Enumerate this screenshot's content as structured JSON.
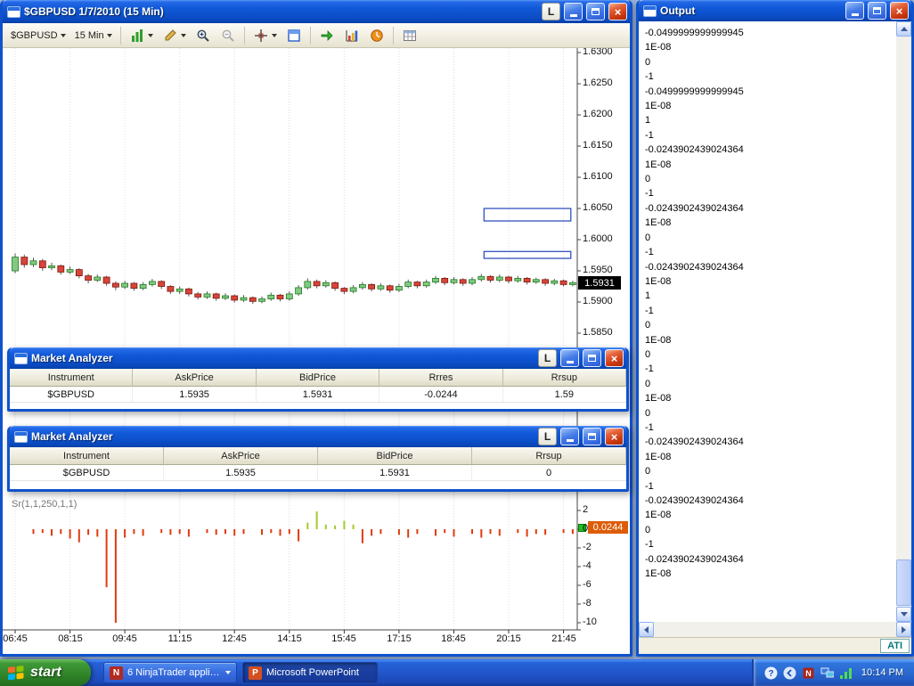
{
  "chart_window": {
    "title": "$GBPUSD  1/7/2010 (15 Min)",
    "link_label": "L",
    "toolbar": {
      "instrument": "$GBPUSD",
      "interval": "15 Min"
    },
    "price_axis_ticks": [
      "1.6300",
      "1.6250",
      "1.6200",
      "1.6150",
      "1.6100",
      "1.6050",
      "1.6000",
      "1.5950",
      "1.5900",
      "1.5850"
    ],
    "indicator_axis_ticks": [
      "2",
      "0",
      "-2",
      "-4",
      "-6",
      "-8",
      "-10"
    ],
    "time_axis_ticks": [
      "06:45",
      "08:15",
      "09:45",
      "11:15",
      "12:45",
      "14:15",
      "15:45",
      "17:15",
      "18:45",
      "20:15",
      "21:45"
    ],
    "price_marker": "1.5931",
    "indicator_label": "Sr(1,1,250,1,1)",
    "indicator_marker": "0.0244"
  },
  "chart_data": [
    {
      "type": "candlestick",
      "title": "$GBPUSD 1/7/2010 15 Min",
      "ylim": [
        1.585,
        1.63
      ],
      "y_ticks": [
        1.63,
        1.625,
        1.62,
        1.615,
        1.61,
        1.605,
        1.6,
        1.595,
        1.59,
        1.585
      ],
      "x_ticks": [
        "06:45",
        "08:15",
        "09:45",
        "11:15",
        "12:45",
        "14:15",
        "15:45",
        "17:15",
        "18:45",
        "20:15",
        "21:45"
      ],
      "last_price": 1.5931,
      "rectangles": [
        {
          "price_top": 1.605,
          "price_bottom": 1.603,
          "x1_bar": 51.3,
          "x2_bar": 60.8
        },
        {
          "price_top": 1.5981,
          "price_bottom": 1.597,
          "x1_bar": 51.3,
          "x2_bar": 60.8
        }
      ],
      "candles": [
        [
          1.595,
          1.5978,
          1.5946,
          1.5972
        ],
        [
          1.5972,
          1.5976,
          1.5955,
          1.596
        ],
        [
          1.596,
          1.5971,
          1.5956,
          1.5966
        ],
        [
          1.5966,
          1.5969,
          1.595,
          1.5955
        ],
        [
          1.5955,
          1.5963,
          1.5951,
          1.5958
        ],
        [
          1.5958,
          1.596,
          1.5944,
          1.5948
        ],
        [
          1.5948,
          1.5957,
          1.5945,
          1.5952
        ],
        [
          1.5952,
          1.5954,
          1.5938,
          1.5942
        ],
        [
          1.5942,
          1.5945,
          1.593,
          1.5935
        ],
        [
          1.5935,
          1.5944,
          1.5932,
          1.594
        ],
        [
          1.594,
          1.5942,
          1.5926,
          1.593
        ],
        [
          1.593,
          1.5933,
          1.5919,
          1.5924
        ],
        [
          1.5924,
          1.5934,
          1.5921,
          1.593
        ],
        [
          1.593,
          1.5932,
          1.5918,
          1.5922
        ],
        [
          1.5922,
          1.5932,
          1.5919,
          1.5928
        ],
        [
          1.5928,
          1.5937,
          1.5925,
          1.5933
        ],
        [
          1.5933,
          1.5935,
          1.5921,
          1.5925
        ],
        [
          1.5925,
          1.5927,
          1.5913,
          1.5917
        ],
        [
          1.5917,
          1.5925,
          1.5913,
          1.5921
        ],
        [
          1.5921,
          1.5923,
          1.5909,
          1.5913
        ],
        [
          1.5913,
          1.5916,
          1.5904,
          1.5908
        ],
        [
          1.5908,
          1.5917,
          1.5905,
          1.5913
        ],
        [
          1.5913,
          1.5915,
          1.5902,
          1.5906
        ],
        [
          1.5906,
          1.5914,
          1.5903,
          1.591
        ],
        [
          1.591,
          1.5912,
          1.5899,
          1.5903
        ],
        [
          1.5903,
          1.5911,
          1.59,
          1.5907
        ],
        [
          1.5907,
          1.5909,
          1.5897,
          1.5901
        ],
        [
          1.5901,
          1.5909,
          1.5898,
          1.5905
        ],
        [
          1.5905,
          1.5915,
          1.5902,
          1.5911
        ],
        [
          1.5911,
          1.5913,
          1.5901,
          1.5905
        ],
        [
          1.5905,
          1.5917,
          1.5902,
          1.5913
        ],
        [
          1.5913,
          1.5927,
          1.591,
          1.5923
        ],
        [
          1.5923,
          1.5938,
          1.592,
          1.5933
        ],
        [
          1.5933,
          1.5936,
          1.5922,
          1.5926
        ],
        [
          1.5926,
          1.5935,
          1.5923,
          1.5931
        ],
        [
          1.5931,
          1.5933,
          1.5918,
          1.5922
        ],
        [
          1.5922,
          1.5924,
          1.5913,
          1.5917
        ],
        [
          1.5917,
          1.5927,
          1.5914,
          1.5923
        ],
        [
          1.5923,
          1.5932,
          1.592,
          1.5928
        ],
        [
          1.5928,
          1.593,
          1.5917,
          1.5921
        ],
        [
          1.5921,
          1.593,
          1.5918,
          1.5926
        ],
        [
          1.5926,
          1.5928,
          1.5915,
          1.5919
        ],
        [
          1.5919,
          1.5929,
          1.5916,
          1.5925
        ],
        [
          1.5925,
          1.5936,
          1.5922,
          1.5932
        ],
        [
          1.5932,
          1.5934,
          1.5922,
          1.5926
        ],
        [
          1.5926,
          1.5936,
          1.5923,
          1.5932
        ],
        [
          1.5932,
          1.5942,
          1.5929,
          1.5938
        ],
        [
          1.5938,
          1.594,
          1.5927,
          1.5931
        ],
        [
          1.5931,
          1.594,
          1.5928,
          1.5936
        ],
        [
          1.5936,
          1.5938,
          1.5926,
          1.593
        ],
        [
          1.593,
          1.594,
          1.5927,
          1.5936
        ],
        [
          1.5936,
          1.5945,
          1.5933,
          1.5941
        ],
        [
          1.5941,
          1.5943,
          1.5931,
          1.5935
        ],
        [
          1.5935,
          1.5944,
          1.5932,
          1.594
        ],
        [
          1.594,
          1.5942,
          1.593,
          1.5934
        ],
        [
          1.5934,
          1.5942,
          1.5931,
          1.5938
        ],
        [
          1.5938,
          1.594,
          1.5928,
          1.5932
        ],
        [
          1.5932,
          1.5939,
          1.5929,
          1.5936
        ],
        [
          1.5936,
          1.5938,
          1.5926,
          1.593
        ],
        [
          1.593,
          1.5937,
          1.5927,
          1.5934
        ],
        [
          1.5934,
          1.5936,
          1.5925,
          1.5928
        ],
        [
          1.5928,
          1.5934,
          1.5925,
          1.5931
        ]
      ]
    },
    {
      "type": "bar",
      "title": "Sr(1,1,250,1,1)",
      "ylim": [
        -10,
        2
      ],
      "y_ticks": [
        2,
        0,
        -2,
        -4,
        -6,
        -8,
        -10
      ],
      "last_value": 0.0244,
      "bars": [
        {
          "i": 2,
          "v": -0.5
        },
        {
          "i": 3,
          "v": -0.4
        },
        {
          "i": 4,
          "v": -0.7
        },
        {
          "i": 5,
          "v": -0.5
        },
        {
          "i": 6,
          "v": -1.0
        },
        {
          "i": 7,
          "v": -1.4
        },
        {
          "i": 8,
          "v": -0.6
        },
        {
          "i": 9,
          "v": -0.8
        },
        {
          "i": 10,
          "v": -6.2
        },
        {
          "i": 11,
          "v": -10.0
        },
        {
          "i": 12,
          "v": -0.9
        },
        {
          "i": 13,
          "v": -0.5
        },
        {
          "i": 14,
          "v": -0.7
        },
        {
          "i": 16,
          "v": -0.4
        },
        {
          "i": 17,
          "v": -0.6
        },
        {
          "i": 18,
          "v": -0.5
        },
        {
          "i": 19,
          "v": -0.8
        },
        {
          "i": 21,
          "v": -0.4
        },
        {
          "i": 22,
          "v": -0.6
        },
        {
          "i": 23,
          "v": -0.5
        },
        {
          "i": 24,
          "v": -0.7
        },
        {
          "i": 25,
          "v": -0.5
        },
        {
          "i": 27,
          "v": -0.6
        },
        {
          "i": 28,
          "v": -0.4
        },
        {
          "i": 29,
          "v": -0.7
        },
        {
          "i": 30,
          "v": -0.5
        },
        {
          "i": 31,
          "v": -1.3
        },
        {
          "i": 32,
          "v": 0.7
        },
        {
          "i": 33,
          "v": 1.9
        },
        {
          "i": 34,
          "v": 0.5
        },
        {
          "i": 35,
          "v": 0.4
        },
        {
          "i": 36,
          "v": 0.9
        },
        {
          "i": 37,
          "v": 0.5
        },
        {
          "i": 38,
          "v": -1.5
        },
        {
          "i": 39,
          "v": -0.7
        },
        {
          "i": 40,
          "v": -0.5
        },
        {
          "i": 42,
          "v": -0.6
        },
        {
          "i": 43,
          "v": -0.9
        },
        {
          "i": 44,
          "v": -0.5
        },
        {
          "i": 46,
          "v": -0.7
        },
        {
          "i": 47,
          "v": -0.4
        },
        {
          "i": 48,
          "v": -0.8
        },
        {
          "i": 50,
          "v": -0.5
        },
        {
          "i": 51,
          "v": -0.9
        },
        {
          "i": 52,
          "v": -0.5
        },
        {
          "i": 53,
          "v": -0.7
        },
        {
          "i": 55,
          "v": -0.4
        },
        {
          "i": 56,
          "v": -0.8
        },
        {
          "i": 57,
          "v": -0.5
        },
        {
          "i": 58,
          "v": -0.6
        },
        {
          "i": 60,
          "v": -0.4
        },
        {
          "i": 61,
          "v": -0.5
        }
      ]
    }
  ],
  "market_analyzer_1": {
    "title": "Market Analyzer",
    "link_label": "L",
    "columns": [
      "Instrument",
      "AskPrice",
      "BidPrice",
      "Rrres",
      "Rrsup"
    ],
    "rows": [
      [
        "$GBPUSD",
        "1.5935",
        "1.5931",
        "-0.0244",
        "1.59"
      ]
    ]
  },
  "market_analyzer_2": {
    "title": "Market Analyzer",
    "link_label": "L",
    "columns": [
      "Instrument",
      "AskPrice",
      "BidPrice",
      "Rrsup"
    ],
    "rows": [
      [
        "$GBPUSD",
        "1.5935",
        "1.5931",
        "0"
      ]
    ]
  },
  "output_window": {
    "title": "Output",
    "status": "ATI",
    "lines": [
      "-0.0499999999999945",
      "1E-08",
      "0",
      "-1",
      "-0.0499999999999945",
      "1E-08",
      "1",
      "-1",
      "-0.0243902439024364",
      "1E-08",
      "0",
      "-1",
      "-0.0243902439024364",
      "1E-08",
      "0",
      "-1",
      "-0.0243902439024364",
      "1E-08",
      "1",
      "-1",
      "0",
      "1E-08",
      "0",
      "-1",
      "0",
      "1E-08",
      "0",
      "-1",
      "-0.0243902439024364",
      "1E-08",
      "0",
      "-1",
      "-0.0243902439024364",
      "1E-08",
      "0",
      "-1",
      "-0.0243902439024364",
      "1E-08"
    ]
  },
  "taskbar": {
    "start_label": "start",
    "tasks": [
      {
        "label": "6 NinjaTrader applic..."
      },
      {
        "label": "Microsoft PowerPoint"
      }
    ],
    "clock": "10:14 PM"
  },
  "colors": {
    "candle_up": "#82c982",
    "candle_down": "#d8453a",
    "hist_up": "#a2cc2a",
    "hist_down": "#e23b10",
    "marker_bg": "#dd5c07",
    "titlebar_blue": "#0c50cc",
    "taskbar_blue": "#2258cd",
    "start_green": "#2f8328"
  }
}
